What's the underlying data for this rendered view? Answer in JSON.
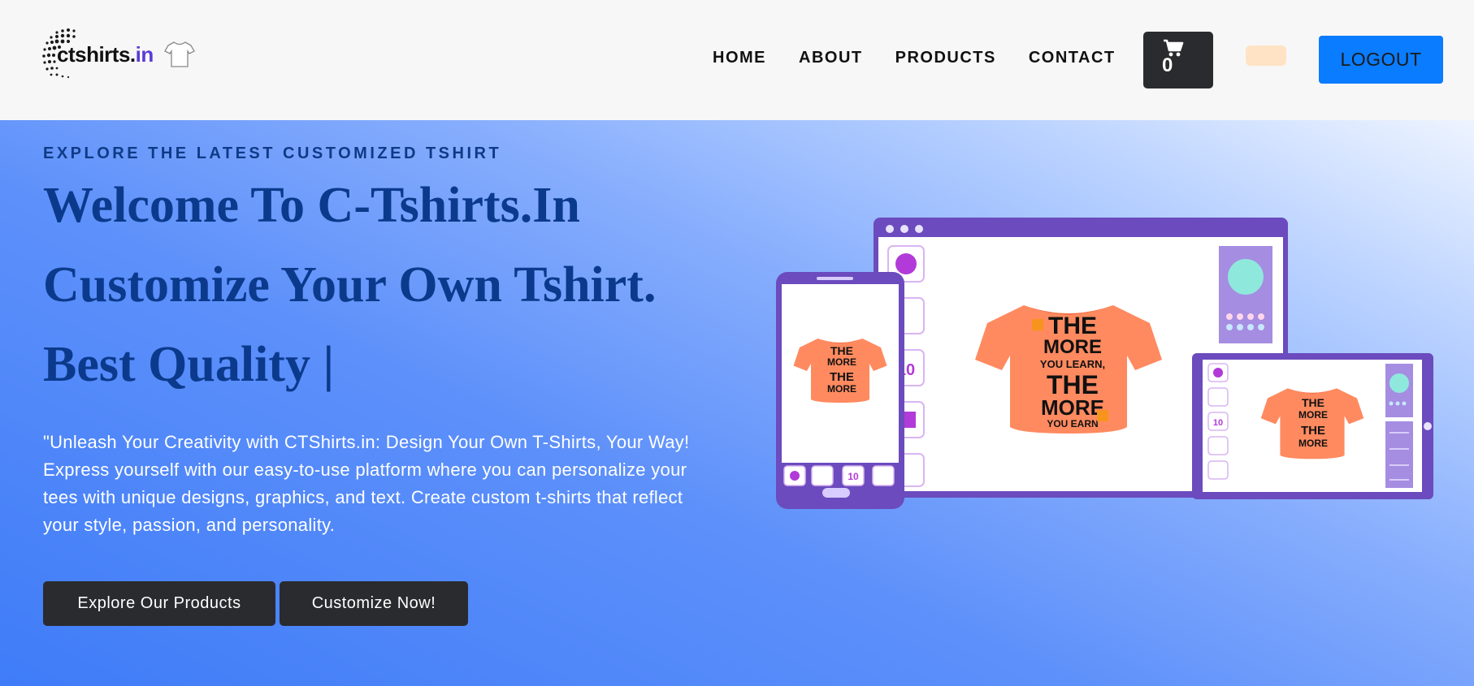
{
  "brand": {
    "name_prefix": "ctshirts.",
    "name_suffix": "in"
  },
  "nav": {
    "links": [
      "HOME",
      "ABOUT",
      "PRODUCTS",
      "CONTACT"
    ],
    "cart_count": "0",
    "logout_label": "LOGOUT"
  },
  "hero": {
    "eyebrow": "EXPLORE THE LATEST CUSTOMIZED TSHIRT",
    "line1": "Welcome To C-Tshirts.In",
    "line2": "Customize Your Own Tshirt.",
    "line3": "Best Quality |",
    "description": "\"Unleash Your Creativity with CTShirts.in: Design Your Own T-Shirts, Your Way! Express yourself with our easy-to-use platform where you can personalize your tees with unique designs, graphics, and text. Create custom t-shirts that reflect your style, passion, and personality.",
    "explore_label": "Explore Our Products",
    "customize_label": "Customize Now!"
  },
  "illustration": {
    "tshirt_text": [
      "THE",
      "MORE",
      "YOU LEARN,",
      "THE",
      "MORE",
      "YOU EARN"
    ],
    "tool_number": "10",
    "colors": {
      "frame": "#6b4bbd",
      "shirt": "#ff8a60",
      "accent": "#f7941d",
      "swatch": "#8fe8dc"
    }
  },
  "colors": {
    "nav_bg": "#f7f7f7",
    "primary_blue": "#0a7cff",
    "dark_button": "#2a2b2e",
    "heading": "#0b3a8c"
  }
}
